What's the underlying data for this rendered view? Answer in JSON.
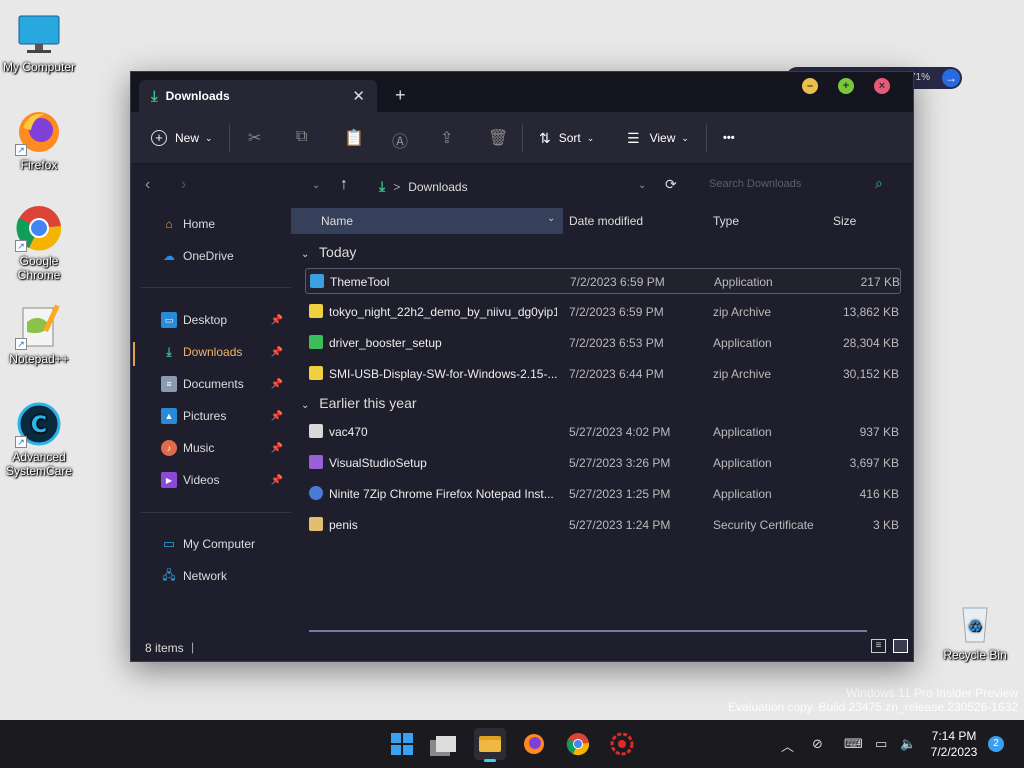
{
  "desktop": {
    "icons": [
      {
        "label": "My Computer"
      },
      {
        "label": "Firefox"
      },
      {
        "label": "Google Chrome"
      },
      {
        "label": "Notepad++"
      },
      {
        "label": "Advanced SystemCare"
      },
      {
        "label": "Recycle Bin"
      }
    ],
    "watermark": {
      "line1": "Windows 11 Pro Insider Preview",
      "line2": "Evaluation copy. Build 23475.zn_release.230526-1632"
    },
    "pill_text": "71%"
  },
  "window": {
    "tab_title": "Downloads",
    "toolbar": {
      "new_label": "New",
      "sort_label": "Sort",
      "view_label": "View",
      "more_label": "•••"
    },
    "breadcrumb": {
      "separator": ">",
      "current": "Downloads"
    },
    "search_placeholder": "Search Downloads",
    "sidebar": {
      "home": "Home",
      "onedrive": "OneDrive",
      "desktop": "Desktop",
      "downloads": "Downloads",
      "documents": "Documents",
      "pictures": "Pictures",
      "music": "Music",
      "videos": "Videos",
      "my_computer": "My Computer",
      "network": "Network"
    },
    "columns": {
      "name": "Name",
      "date": "Date modified",
      "type": "Type",
      "size": "Size"
    },
    "groups": {
      "today": "Today",
      "earlier": "Earlier this year"
    },
    "files": [
      {
        "name": "ThemeTool",
        "date": "7/2/2023 6:59 PM",
        "type": "Application",
        "size": "217 KB",
        "color": "#3aa0e0"
      },
      {
        "name": "tokyo_night_22h2_demo_by_niivu_dg0yip1",
        "date": "7/2/2023 6:59 PM",
        "type": "zip Archive",
        "size": "13,862 KB",
        "color": "#f0d040"
      },
      {
        "name": "driver_booster_setup",
        "date": "7/2/2023 6:53 PM",
        "type": "Application",
        "size": "28,304 KB",
        "color": "#3cbf5a"
      },
      {
        "name": "SMI-USB-Display-SW-for-Windows-2.15-...",
        "date": "7/2/2023 6:44 PM",
        "type": "zip Archive",
        "size": "30,152 KB",
        "color": "#f0d040"
      },
      {
        "name": "vac470",
        "date": "5/27/2023 4:02 PM",
        "type": "Application",
        "size": "937 KB",
        "color": "#d8d8d8"
      },
      {
        "name": "VisualStudioSetup",
        "date": "5/27/2023 3:26 PM",
        "type": "Application",
        "size": "3,697 KB",
        "color": "#9a60d8"
      },
      {
        "name": "Ninite 7Zip Chrome Firefox Notepad Inst...",
        "date": "5/27/2023 1:25 PM",
        "type": "Application",
        "size": "416 KB",
        "color": "#4a7ad8"
      },
      {
        "name": "penis",
        "date": "5/27/2023 1:24 PM",
        "type": "Security Certificate",
        "size": "3 KB",
        "color": "#e0c070"
      }
    ],
    "status": "8 items",
    "status_sep": "|"
  },
  "taskbar": {
    "time": "7:14 PM",
    "date": "7/2/2023",
    "badge": "2"
  }
}
